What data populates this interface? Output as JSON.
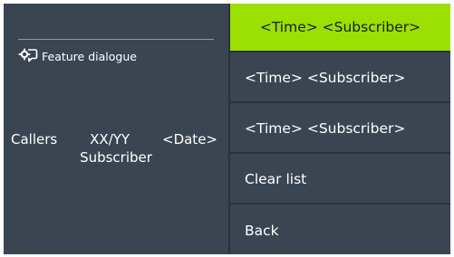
{
  "left_panel": {
    "feature_label": "Feature dialogue",
    "status_callers": "Callers",
    "status_count": "XX/YY",
    "status_date": "<Date>",
    "status_subscriber": "Subscriber"
  },
  "menu": {
    "items": [
      {
        "label": "<Time> <Subscriber>",
        "selected": true
      },
      {
        "label": "<Time> <Subscriber>",
        "selected": false
      },
      {
        "label": "<Time> <Subscriber>",
        "selected": false
      },
      {
        "label": "Clear list",
        "selected": false
      },
      {
        "label": "Back",
        "selected": false
      }
    ]
  },
  "colors": {
    "background": "#3b4552",
    "selected": "#9be000",
    "text": "#ffffff"
  },
  "icons": {
    "feature": "chat-bubble-gear-icon"
  }
}
